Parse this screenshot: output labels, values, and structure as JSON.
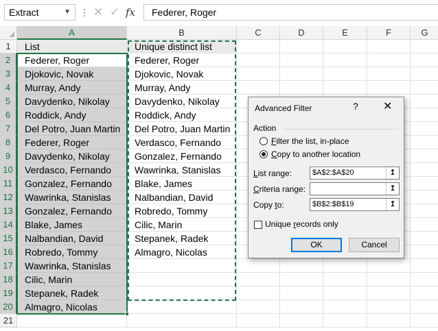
{
  "formula_bar": {
    "name_box": "Extract",
    "name_box_icon": "chevron-down-icon",
    "cancel_icon": "x-icon",
    "enter_icon": "check-icon",
    "fx_label": "fx",
    "formula": "Federer, Roger"
  },
  "columns": [
    "A",
    "B",
    "C",
    "D",
    "E",
    "F",
    "G"
  ],
  "rows": [
    "1",
    "2",
    "3",
    "4",
    "5",
    "6",
    "7",
    "8",
    "9",
    "10",
    "11",
    "12",
    "13",
    "14",
    "15",
    "16",
    "17",
    "18",
    "19",
    "20",
    "21"
  ],
  "colA": [
    "List",
    "Federer, Roger",
    "Djokovic, Novak",
    "Murray, Andy",
    "Davydenko, Nikolay",
    "Roddick, Andy",
    "Del Potro, Juan Martin",
    "Federer, Roger",
    "Davydenko, Nikolay",
    "Verdasco, Fernando",
    "Gonzalez, Fernando",
    "Wawrinka, Stanislas",
    "Gonzalez, Fernando",
    "Blake, James",
    "Nalbandian, David",
    "Robredo, Tommy",
    "Wawrinka, Stanislas",
    "Cilic, Marin",
    "Stepanek, Radek",
    "Almagro, Nicolas",
    ""
  ],
  "colB": [
    "Unique distinct list",
    "Federer, Roger",
    "Djokovic, Novak",
    "Murray, Andy",
    "Davydenko, Nikolay",
    "Roddick, Andy",
    "Del Potro, Juan Martin",
    "Verdasco, Fernando",
    "Gonzalez, Fernando",
    "Wawrinka, Stanislas",
    "Blake, James",
    "Nalbandian, David",
    "Robredo, Tommy",
    "Cilic, Marin",
    "Stepanek, Radek",
    "Almagro, Nicolas",
    "",
    "",
    "",
    "",
    ""
  ],
  "dialog": {
    "title": "Advanced Filter",
    "help": "?",
    "close": "✕",
    "action_label": "Action",
    "opt_filter_pre": "F",
    "opt_filter_rest": "ilter the list, in-place",
    "opt_copy_pre": "C",
    "opt_copy_rest": "opy to another location",
    "list_range_pre": "L",
    "list_range_rest": "ist range:",
    "list_range_value": "$A$2:$A$20",
    "criteria_pre": "C",
    "criteria_rest": "riteria range:",
    "criteria_value": "",
    "copy_to_pre": "Copy ",
    "copy_to_u": "t",
    "copy_to_rest": "o:",
    "copy_to_value": "$B$2:$B$19",
    "ref_icon": "↥",
    "unique_pre": "Unique ",
    "unique_u": "r",
    "unique_rest": "ecords only",
    "ok": "OK",
    "cancel": "Cancel"
  },
  "colors": {
    "accent": "#217346",
    "ok_border": "#0078d7"
  }
}
